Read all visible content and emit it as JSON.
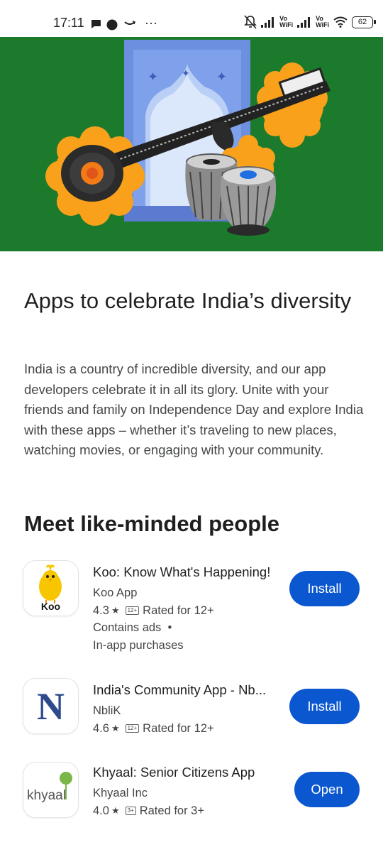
{
  "status_bar": {
    "time": "17:11",
    "more": "···",
    "vowifi_1": "Vo\nWiFi",
    "vowifi_2": "Vo\nWiFi",
    "battery": "62"
  },
  "banner": {
    "background_color": "#1c7a2c",
    "illustration": "sitar-tabla-window"
  },
  "collection": {
    "title": "Apps to celebrate India’s diversity",
    "description": "India is a country of incredible diversity, and our app developers celebrate it in all its glory. Unite with your friends and family on Independence Day and explore India with these apps – whether it’s traveling to new places, watching movies, or engaging with your community."
  },
  "section": {
    "title": "Meet like-minded people"
  },
  "apps": [
    {
      "name": "Koo: Know What's Happening!",
      "developer": "Koo App",
      "rating": "4.3",
      "age_badge": "12+",
      "age_text": "Rated for 12+",
      "extra_1": "Contains ads  •",
      "extra_2": "In-app purchases",
      "button": "Install",
      "icon_text": "Koo"
    },
    {
      "name": "India's Community App - Nb...",
      "developer": "NbliK",
      "rating": "4.6",
      "age_badge": "12+",
      "age_text": "Rated for 12+",
      "button": "Install",
      "icon_text": "N"
    },
    {
      "name": "Khyaal: Senior Citizens App",
      "developer": "Khyaal Inc",
      "rating": "4.0",
      "age_badge": "3+",
      "age_text": "Rated for 3+",
      "button": "Open",
      "icon_text": "khyaal"
    }
  ],
  "colors": {
    "accent": "#0b57d0",
    "banner_green": "#1c7a2c",
    "marigold": "#f9a11b"
  }
}
